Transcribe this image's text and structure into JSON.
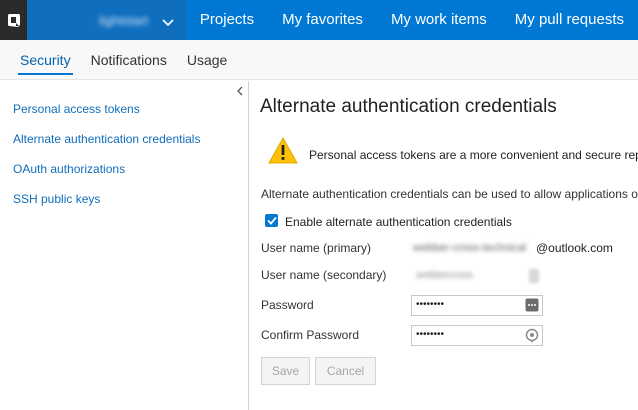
{
  "header": {
    "account_name": "lightstart",
    "nav": [
      "Projects",
      "My favorites",
      "My work items",
      "My pull requests"
    ]
  },
  "subtabs": [
    "Security",
    "Notifications",
    "Usage"
  ],
  "leftnav": {
    "items": [
      "Personal access tokens",
      "Alternate authentication credentials",
      "OAuth authorizations",
      "SSH public keys"
    ]
  },
  "main": {
    "title": "Alternate authentication credentials",
    "warning": "Personal access tokens are a more convenient and secure replacement",
    "description": "Alternate authentication credentials can be used to allow applications or tools",
    "checkbox_label": "Enable alternate authentication credentials",
    "checkbox_checked": true,
    "fields": {
      "primary_label": "User name (primary)",
      "primary_value_obscured": "webber-cross-technical",
      "primary_suffix": "@outlook.com",
      "secondary_label": "User name (secondary)",
      "secondary_value_obscured": "webbercross",
      "password_label": "Password",
      "password_value": "••••••••",
      "confirm_label": "Confirm Password",
      "confirm_value": "••••••••"
    },
    "buttons": {
      "save": "Save",
      "cancel": "Cancel"
    }
  },
  "colors": {
    "accent": "#0078d4",
    "link": "#106ebe",
    "warning": "#ffc107"
  }
}
